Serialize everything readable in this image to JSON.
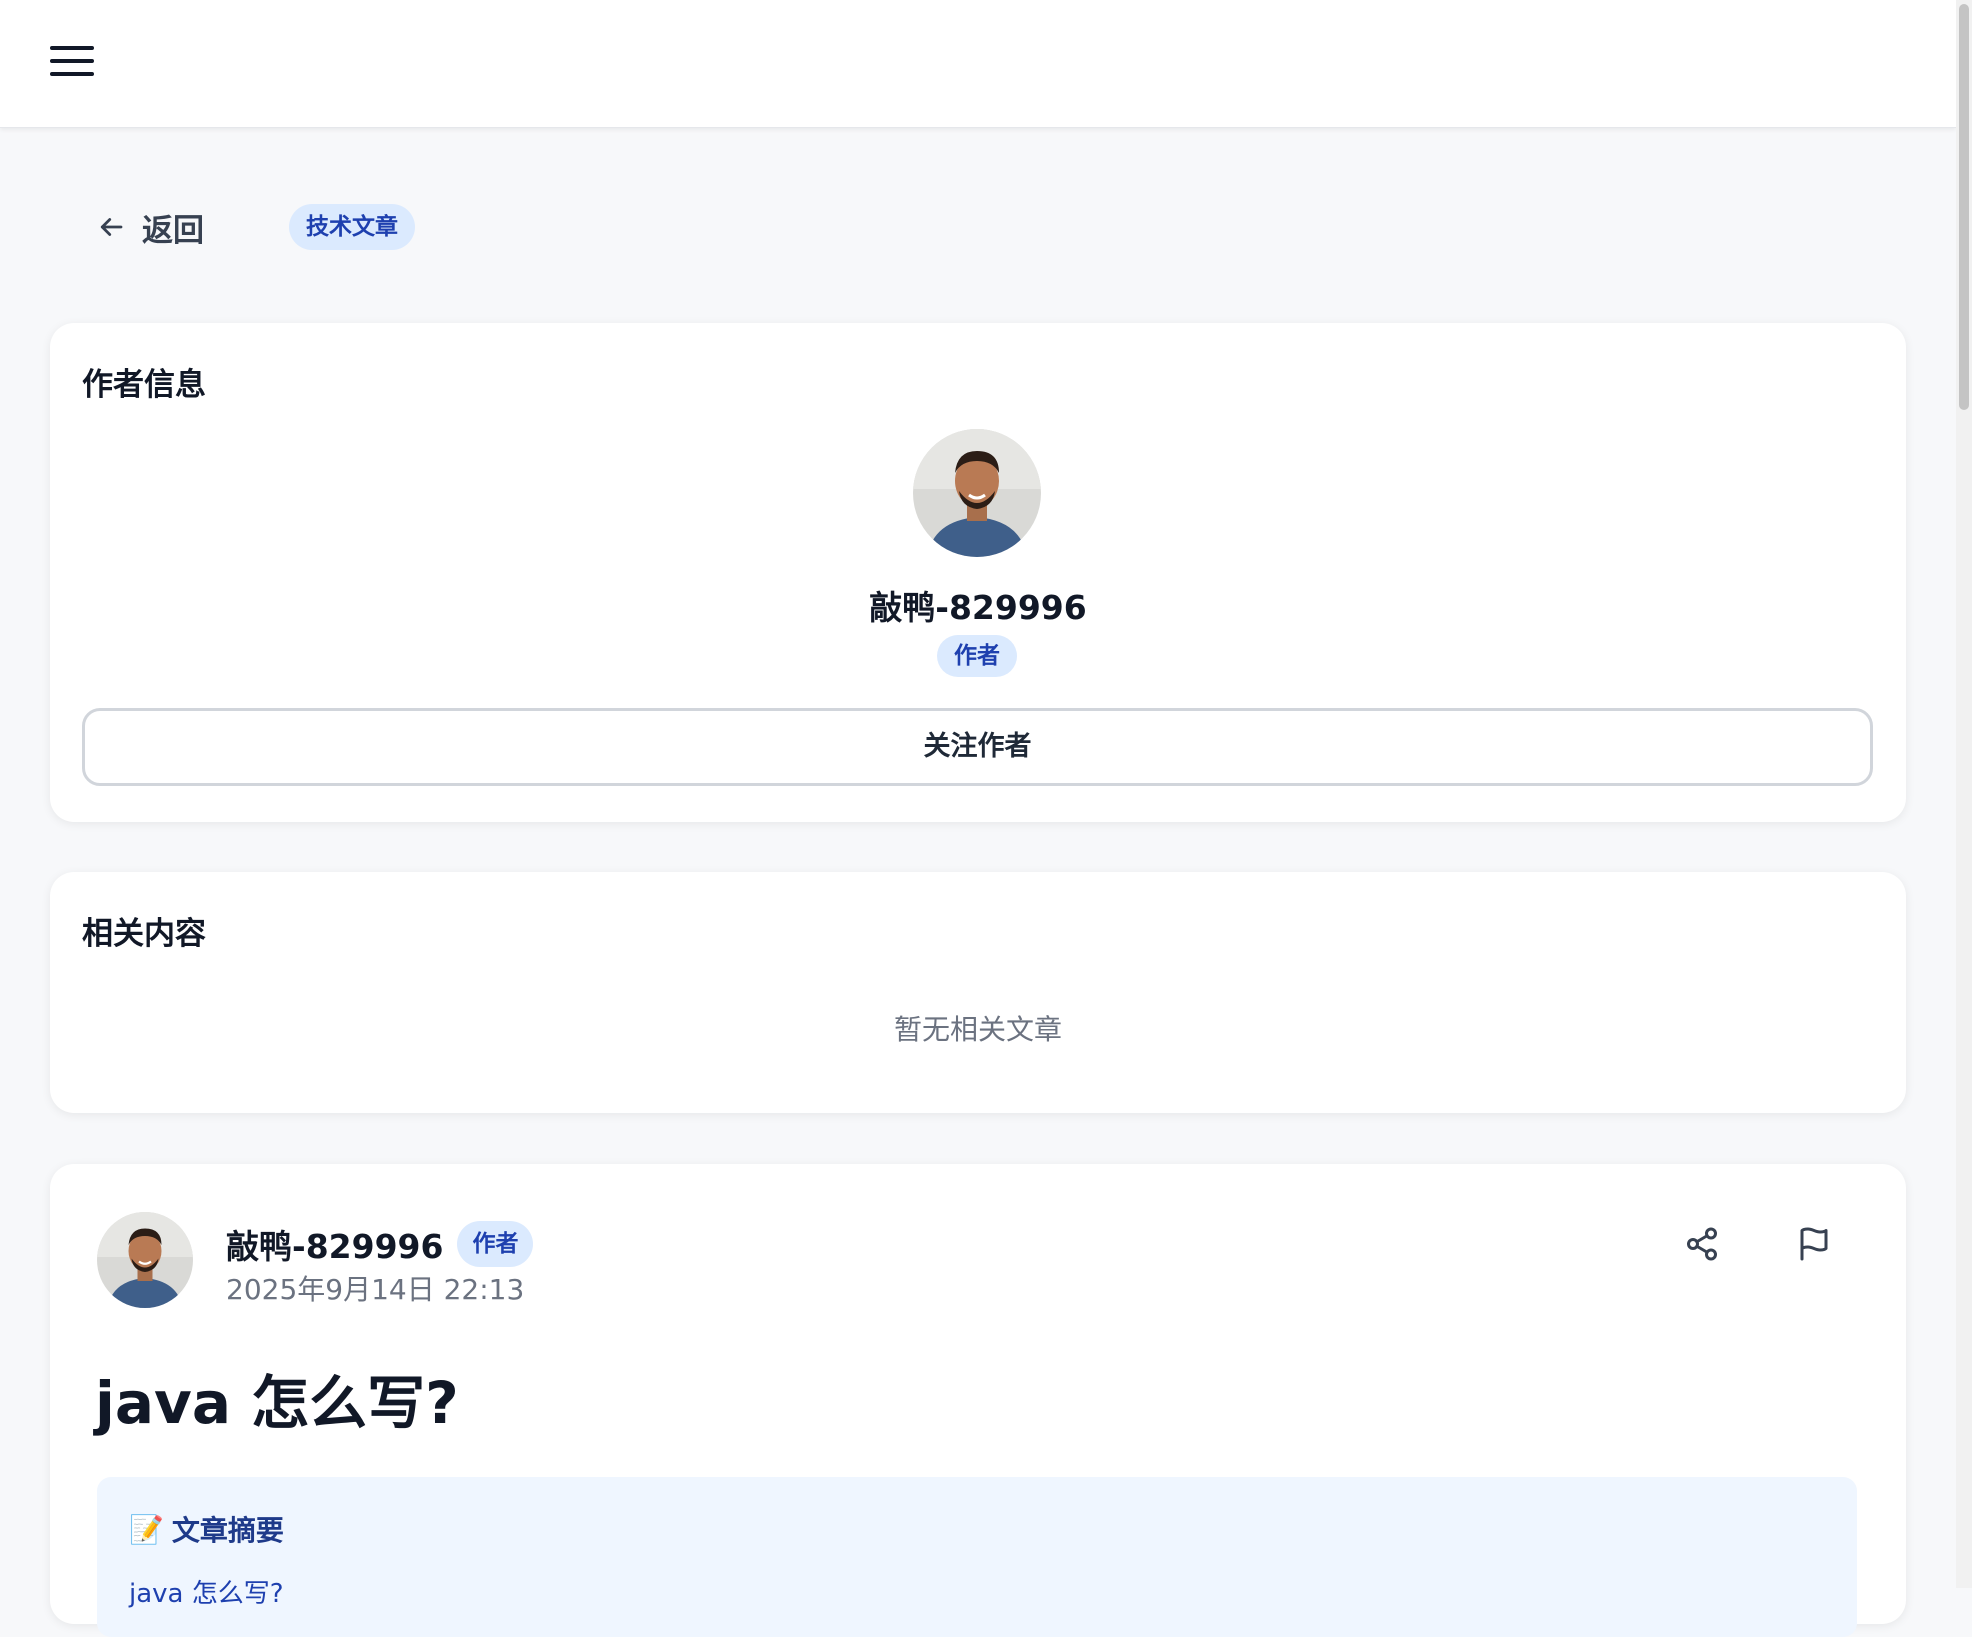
{
  "header": {
    "menu_icon": "hamburger-menu-icon"
  },
  "nav": {
    "back_label": "返回",
    "back_icon": "arrow-left-icon",
    "category_tag": "技术文章"
  },
  "author_card": {
    "title": "作者信息",
    "name": "敲鸭-829996",
    "role_badge": "作者",
    "follow_label": "关注作者"
  },
  "related_card": {
    "title": "相关内容",
    "empty_text": "暂无相关文章"
  },
  "post": {
    "author_name": "敲鸭-829996",
    "author_badge": "作者",
    "timestamp": "2025年9月14日 22:13",
    "share_icon": "share-icon",
    "report_icon": "flag-icon",
    "title": "java 怎么写?",
    "summary_icon": "memo-icon",
    "summary_title": "文章摘要",
    "summary_text": "java 怎么写?"
  },
  "colors": {
    "accent_bg": "#dbeafe",
    "accent_text": "#1e40af",
    "page_bg": "#f7f8fa",
    "summary_bg": "#eff6ff"
  }
}
